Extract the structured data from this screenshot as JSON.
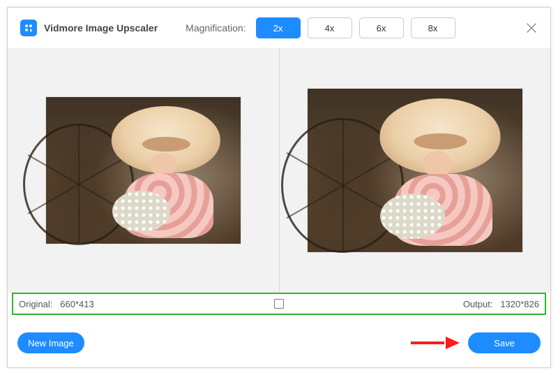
{
  "app_title": "Vidmore Image Upscaler",
  "magnification": {
    "label": "Magnification:",
    "options": [
      "2x",
      "4x",
      "6x",
      "8x"
    ],
    "active": "2x"
  },
  "dimensions": {
    "original_label": "Original:",
    "original_value": "660*413",
    "output_label": "Output:",
    "output_value": "1320*826"
  },
  "buttons": {
    "new_image": "New Image",
    "save": "Save"
  },
  "icons": {
    "logo": "vidmore-logo",
    "close": "close-icon"
  },
  "colors": {
    "accent": "#1e8cff",
    "highlight_border": "#2fb52f",
    "annotation_arrow": "#ff1a1a"
  }
}
